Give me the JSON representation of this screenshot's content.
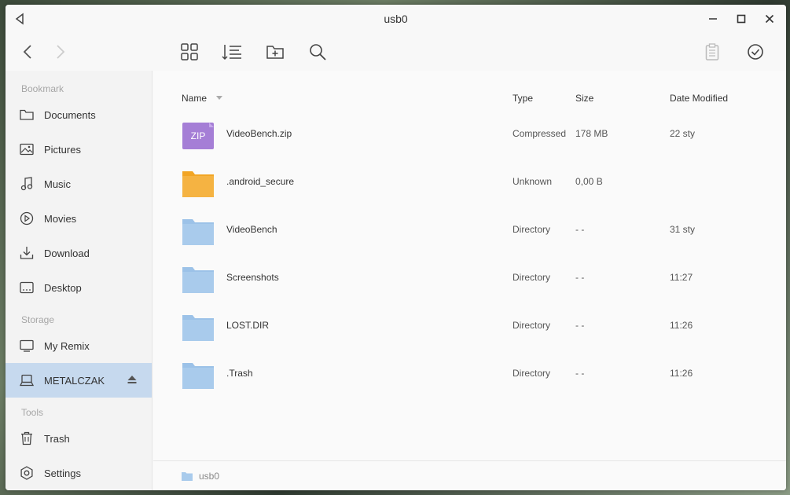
{
  "window": {
    "title": "usb0"
  },
  "sidebar": {
    "bookmark_label": "Bookmark",
    "bookmarks": [
      {
        "label": "Documents",
        "icon": "folder-icon"
      },
      {
        "label": "Pictures",
        "icon": "image-icon"
      },
      {
        "label": "Music",
        "icon": "music-note-icon"
      },
      {
        "label": "Movies",
        "icon": "play-circle-icon"
      },
      {
        "label": "Download",
        "icon": "download-icon"
      },
      {
        "label": "Desktop",
        "icon": "desktop-icon"
      }
    ],
    "storage_label": "Storage",
    "storage": [
      {
        "label": "My Remix",
        "icon": "monitor-icon"
      },
      {
        "label": "METALCZAK",
        "icon": "drive-icon",
        "active": true
      }
    ],
    "tools_label": "Tools",
    "tools": [
      {
        "label": "Trash",
        "icon": "trash-icon"
      },
      {
        "label": "Settings",
        "icon": "settings-icon"
      }
    ]
  },
  "table": {
    "headers": {
      "name": "Name",
      "type": "Type",
      "size": "Size",
      "date": "Date Modified"
    },
    "rows": [
      {
        "name": "VideoBench.zip",
        "type": "Compressed",
        "size": "178 MB",
        "date": "22 sty",
        "kind": "zip",
        "badge": "ZIP"
      },
      {
        "name": ".android_secure",
        "type": "Unknown",
        "size": "0,00 B",
        "date": "",
        "kind": "folder-orange"
      },
      {
        "name": "VideoBench",
        "type": "Directory",
        "size": "- -",
        "date": "31 sty",
        "kind": "folder"
      },
      {
        "name": "Screenshots",
        "type": "Directory",
        "size": "- -",
        "date": "11:27",
        "kind": "folder"
      },
      {
        "name": "LOST.DIR",
        "type": "Directory",
        "size": "- -",
        "date": "11:26",
        "kind": "folder"
      },
      {
        "name": ".Trash",
        "type": "Directory",
        "size": "- -",
        "date": "11:26",
        "kind": "folder"
      }
    ]
  },
  "statusbar": {
    "path": "usb0"
  },
  "colors": {
    "accent": "#c6d9ee",
    "folder_blue": "#a9cbec",
    "folder_orange": "#f5b342",
    "zip_purple": "#a57ed6"
  }
}
